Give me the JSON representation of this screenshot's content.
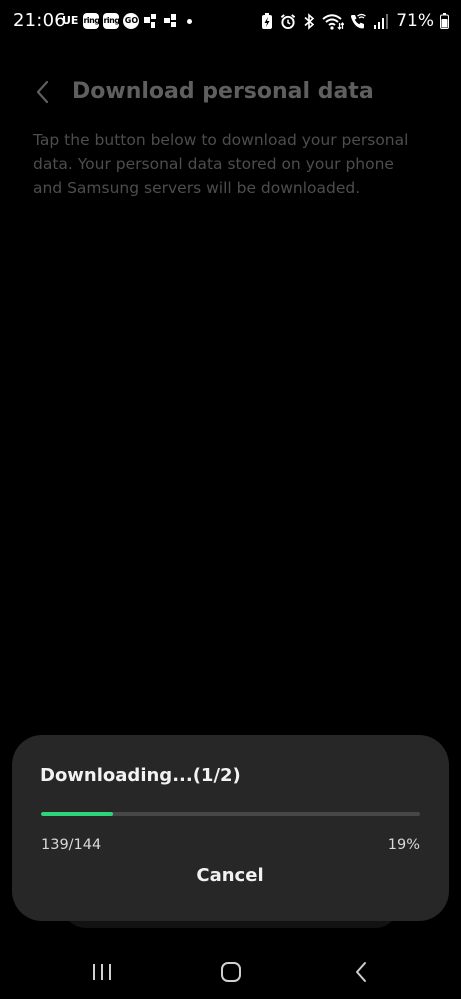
{
  "status_bar": {
    "time": "21:06",
    "carrier_label": "UE",
    "notification_icons": [
      "ring",
      "ring",
      "GO"
    ],
    "battery_percent": "71%"
  },
  "header": {
    "title": "Download personal data",
    "back_icon": "chevron-left-icon"
  },
  "description": "Tap the button below to download your personal data. Your personal data stored on your phone and Samsung servers will be downloaded.",
  "dialog": {
    "title": "Downloading...(1/2)",
    "progress_fraction": 0.19,
    "progress_count": "139/144",
    "progress_percent": "19%",
    "cancel_label": "Cancel"
  },
  "colors": {
    "background": "#000000",
    "dialog_background": "#272727",
    "progress_fill": "#2ed47a",
    "progress_track": "#474747",
    "title_text": "#5f5f5f",
    "description_text": "#4d4d4d"
  },
  "nav_bar": {
    "recents_icon": "recents-icon",
    "home_icon": "home-icon",
    "back_icon": "back-icon"
  }
}
